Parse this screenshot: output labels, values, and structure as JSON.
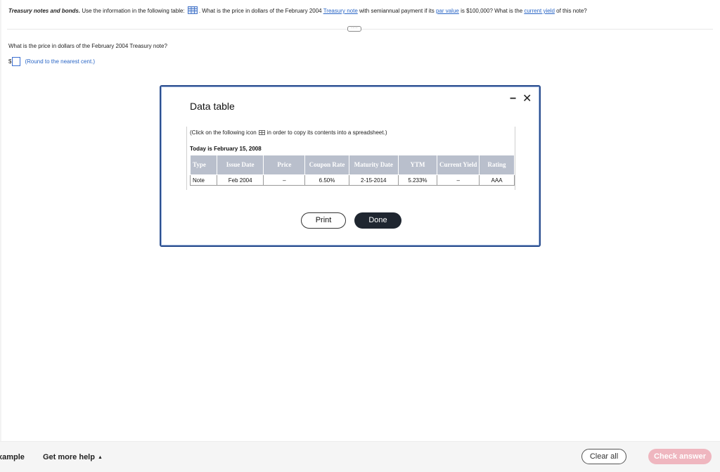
{
  "question": {
    "lead": "Treasury notes and bonds.",
    "part1": " Use the information in the following table: ",
    "part2": ". What is the price in dollars of the February 2004 ",
    "link_note": "Treasury note",
    "part3": " with semiannual payment if its ",
    "link_par": "par value",
    "part4": " is $100,000? What is the ",
    "link_yield": "current yield",
    "part5": " of this note?"
  },
  "subquestion": {
    "text": "What is the price in dollars of the February 2004 Treasury note?",
    "currency": "$",
    "hint": "(Round to the nearest cent.)"
  },
  "modal": {
    "title": "Data table",
    "copy_note_before": "(Click on the following icon",
    "copy_note_after": "in order to copy its contents into a spreadsheet.)",
    "today": "Today is February 15, 2008",
    "print_label": "Print",
    "done_label": "Done",
    "table": {
      "headers": [
        "Type",
        "Issue Date",
        "Price",
        "Coupon Rate",
        "Maturity Date",
        "YTM",
        "Current Yield",
        "Rating"
      ],
      "rows": [
        [
          "Note",
          "Feb 2004",
          "–",
          "6.50%",
          "2-15-2014",
          "5.233%",
          "–",
          "AAA"
        ]
      ]
    }
  },
  "footer": {
    "example_label": "xample",
    "help_label": "Get more help",
    "clear_label": "Clear all",
    "check_label": "Check answer"
  },
  "colors": {
    "accent_link": "#2a66c6",
    "modal_border": "#2c4f8f",
    "table_header_bg": "#b9bfcc",
    "done_button_bg": "#1f2630",
    "check_button_bg": "#efb6bf"
  },
  "icons": [
    "table-icon",
    "more-icon",
    "copy-spreadsheet-icon",
    "minimize-icon",
    "close-icon",
    "caret-up-icon"
  ]
}
